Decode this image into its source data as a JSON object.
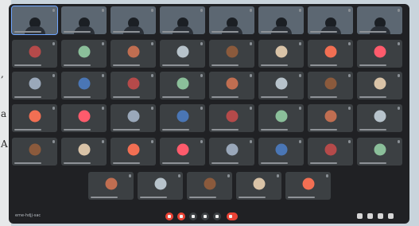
{
  "edge_text": [
    ",",
    "a",
    "A"
  ],
  "meeting": {
    "code": "eme-hdjj-sac"
  },
  "rows": [
    {
      "type": "video",
      "count": 8
    },
    {
      "type": "avatar",
      "count": 8
    },
    {
      "type": "avatar",
      "count": 8
    },
    {
      "type": "avatar",
      "count": 8
    },
    {
      "type": "avatar",
      "count": 8
    },
    {
      "type": "avatar",
      "count": 5
    }
  ],
  "colors": {
    "meet_bg": "#202124",
    "tile_bg": "#3c4043",
    "end_call": "#ea4335",
    "selected_outline": "#6fa6ff",
    "avatar_palette": [
      "#c06e51",
      "#b7c3cb",
      "#8b5a3c",
      "#d9c3a7",
      "#f26f53",
      "#ff5b6c",
      "#9aa8ba",
      "#4a76b5",
      "#b54a4a",
      "#8bbf9a"
    ]
  },
  "controls": {
    "left": [
      "mic-icon",
      "camera-icon",
      "captions-icon",
      "present-icon",
      "more-icon",
      "end-call-icon"
    ],
    "right": [
      "info-icon",
      "people-icon",
      "chat-icon",
      "activities-icon"
    ]
  }
}
